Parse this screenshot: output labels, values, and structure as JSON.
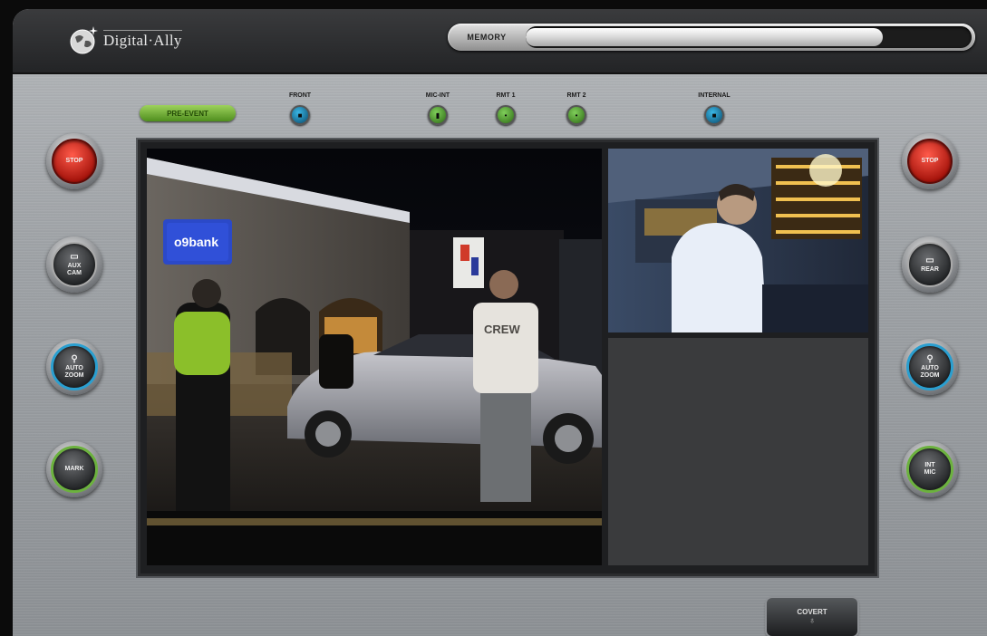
{
  "header": {
    "logo_text": "Digital·Ally",
    "memory_label": "MEMORY",
    "memory_fill": 0.8
  },
  "status": {
    "pre_event_label": "PRE-EVENT",
    "indicators": [
      {
        "label": "FRONT",
        "color": "#2a9fd0",
        "icon": "camera-icon"
      },
      {
        "label": "MIC-INT",
        "color": "#6cb23e",
        "icon": "microphone-icon"
      },
      {
        "label": "RMT 1",
        "color": "#6cb23e",
        "icon": "remote-mic-icon"
      },
      {
        "label": "RMT 2",
        "color": "#6cb23e",
        "icon": "remote-mic-icon"
      },
      {
        "label": "INTERNAL",
        "color": "#2a9fd0",
        "icon": "camera-icon"
      }
    ]
  },
  "left_controls": {
    "stop": "STOP",
    "aux_cam_1": "AUX",
    "aux_cam_2": "CAM",
    "auto_zoom_1": "AUTO",
    "auto_zoom_2": "ZOOM",
    "mark": "MARK"
  },
  "right_controls": {
    "stop": "STOP",
    "rear": "REAR",
    "auto_zoom_1": "AUTO",
    "auto_zoom_2": "ZOOM",
    "int_mic_1": "INT",
    "int_mic_2": "MIC"
  },
  "footer": {
    "covert_label": "COVERT"
  },
  "colors": {
    "stop_red": "#c8180d",
    "accent_blue": "#2a9fd0",
    "accent_green": "#6cb23e"
  }
}
